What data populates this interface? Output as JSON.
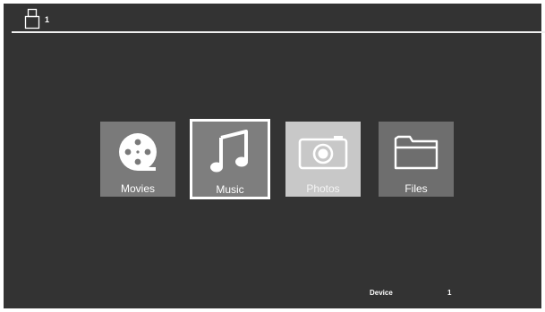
{
  "header": {
    "device_number": "1",
    "usb_icon": "usb-stick-icon"
  },
  "menu": {
    "tiles": [
      {
        "label": "Movies",
        "icon": "film-reel-icon",
        "selected": false
      },
      {
        "label": "Music",
        "icon": "music-note-icon",
        "selected": true
      },
      {
        "label": "Photos",
        "icon": "camera-icon",
        "selected": false
      },
      {
        "label": "Files",
        "icon": "folder-icon",
        "selected": false
      }
    ]
  },
  "footer": {
    "device_label": "Device",
    "device_value": "1"
  },
  "colors": {
    "background": "#333333",
    "tile": "#7a7a7a",
    "photos_tile": "#c8c8c8",
    "selection_border": "#ffffff"
  }
}
